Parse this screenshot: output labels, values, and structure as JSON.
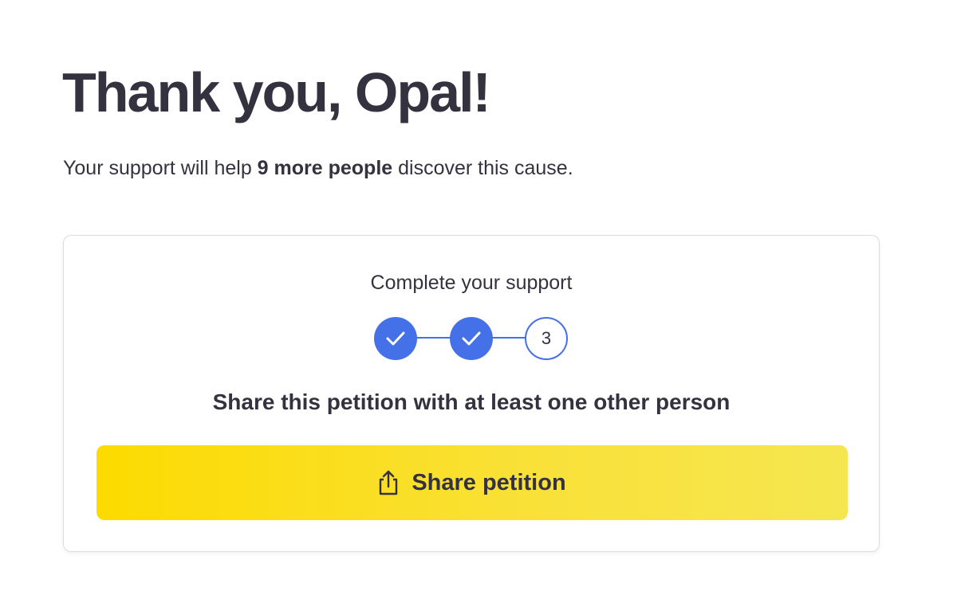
{
  "header": {
    "title": "Thank you, Opal!",
    "subtitle_prefix": "Your support will help ",
    "subtitle_bold": "9 more people",
    "subtitle_suffix": " discover this cause."
  },
  "support_card": {
    "title": "Complete your support",
    "steps": [
      {
        "state": "completed",
        "icon": "checkmark-icon"
      },
      {
        "state": "completed",
        "icon": "checkmark-icon"
      },
      {
        "state": "current",
        "label": "3"
      }
    ],
    "instruction": "Share this petition with at least one other person",
    "share_button": {
      "label": "Share petition",
      "icon": "share-icon"
    }
  },
  "colors": {
    "text": "#35323f",
    "accent_blue": "#4470e8",
    "button_yellow": "#fcdb00",
    "card_border": "#dcdbe0"
  }
}
